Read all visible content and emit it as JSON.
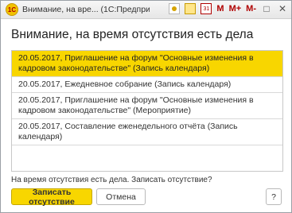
{
  "window": {
    "title": "Внимание, на вре... (1С:Предприятие)",
    "toolbar_text_m": "M",
    "toolbar_text_mplus": "M+",
    "toolbar_text_mminus": "M-",
    "minimize_glyph": "□",
    "close_glyph": "✕",
    "app_icon_glyph": "1С"
  },
  "heading": "Внимание, на время отсутствия есть дела",
  "items": [
    {
      "text": "20.05.2017, Приглашение на форум \"Основные изменения в кадровом законодательстве\" (Запись календаря)",
      "selected": true
    },
    {
      "text": "20.05.2017, Ежедневное собрание (Запись календаря)",
      "selected": false
    },
    {
      "text": "20.05.2017, Приглашение на форум \"Основные изменения в кадровом законодательстве\" (Мероприятие)",
      "selected": false
    },
    {
      "text": "20.05.2017, Составление еженедельного отчёта (Запись календаря)",
      "selected": false
    }
  ],
  "question": "На время отсутствия есть дела. Записать отсутствие?",
  "buttons": {
    "record": "Записать отсутствие",
    "cancel": "Отмена",
    "help": "?"
  },
  "colors": {
    "accent": "#f8d600",
    "brand_red": "#b00000"
  }
}
